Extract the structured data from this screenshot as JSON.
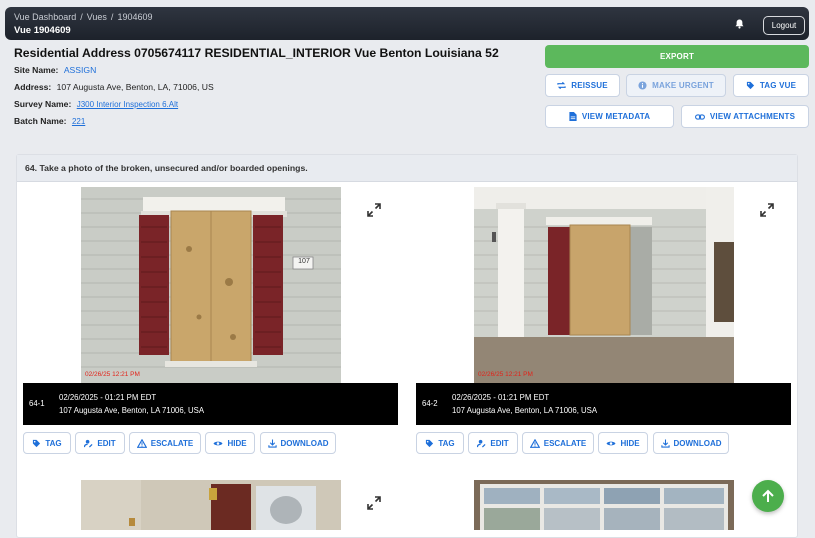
{
  "topbar": {
    "breadcrumbs": [
      "Vue Dashboard",
      "Vues",
      "1904609"
    ],
    "subtitle": "Vue 1904609",
    "bell_icon": "bell-icon",
    "logout_label": "Logout"
  },
  "header": {
    "title": "Residential Address 0705674117 RESIDENTIAL_INTERIOR Vue Benton Louisiana 52",
    "site_name_label": "Site Name:",
    "site_name_value": "ASSIGN",
    "address_label": "Address:",
    "address_value": "107 Augusta Ave, Benton, LA, 71006, US",
    "survey_label": "Survey Name:",
    "survey_value": "J300 Interior Inspection 6.Alt",
    "batch_label": "Batch Name:",
    "batch_value": "221"
  },
  "actions": {
    "export": "EXPORT",
    "reissue": "REISSUE",
    "make_urgent": "MAKE URGENT",
    "tag_vue": "TAG VUE",
    "view_metadata": "VIEW METADATA",
    "view_attachments": "VIEW ATTACHMENTS"
  },
  "question": {
    "title": "64. Take a photo of the broken, unsecured and/or boarded openings."
  },
  "photos": [
    {
      "id": "64-1",
      "datetime": "02/26/2025 - 01:21 PM EDT",
      "address": "107 Augusta Ave, Benton, LA 71006, USA",
      "stamp": "02/26/25 12:21 PM",
      "house_number": "107"
    },
    {
      "id": "64-2",
      "datetime": "02/26/2025 - 01:21 PM EDT",
      "address": "107 Augusta Ave, Benton, LA 71006, USA",
      "stamp": "02/26/25 12:21 PM"
    }
  ],
  "photo_actions": {
    "tag": "TAG",
    "edit": "EDIT",
    "escalate": "ESCALATE",
    "hide": "HIDE",
    "download": "DOWNLOAD"
  },
  "colors": {
    "accent": "#1e6fd9",
    "export": "#5cb85c",
    "fab": "#4cae4c",
    "topbar": "#1d222b",
    "stamp": "#e2231a"
  },
  "fab_icon": "arrow-up-icon"
}
